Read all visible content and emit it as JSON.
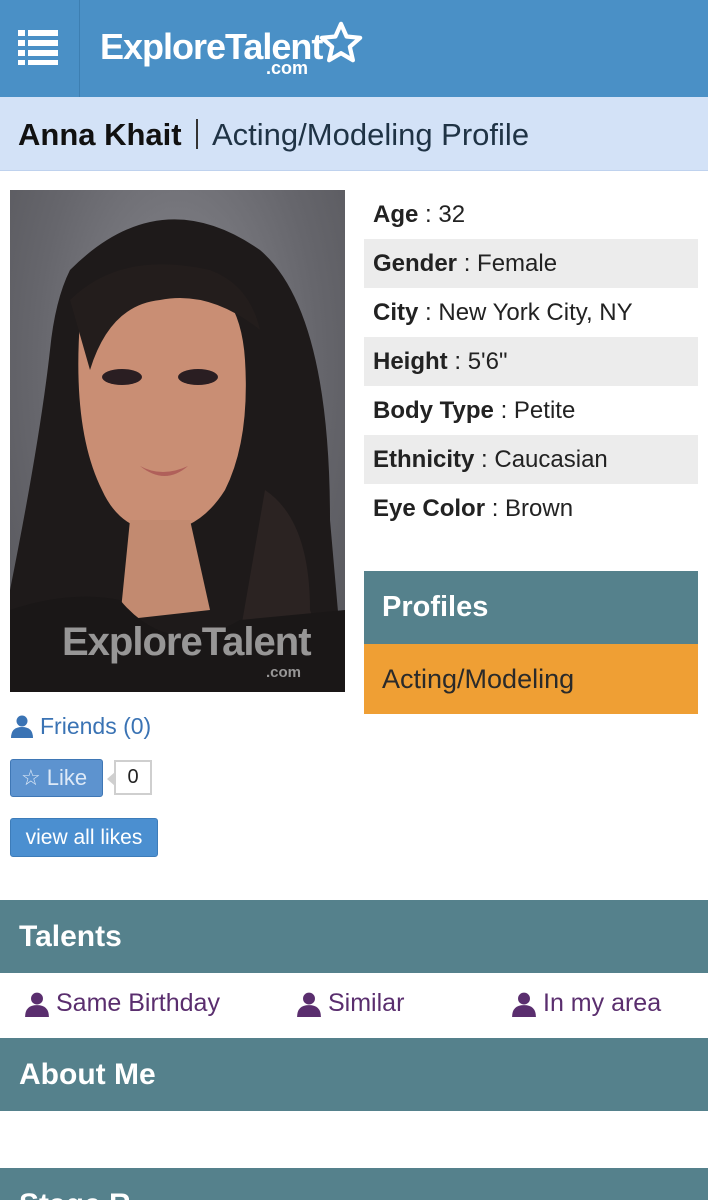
{
  "header": {
    "menu_icon": "list-menu-icon",
    "logo_text": "ExploreTalent",
    "logo_com": ".com",
    "logo_star_icon": "star-outline-icon",
    "brand_color": "#4a90c6"
  },
  "profile": {
    "name": "Anna Khait",
    "subtitle": "Acting/Modeling Profile"
  },
  "photo": {
    "watermark": "ExploreTalent",
    "watermark_com": ".com"
  },
  "details": [
    {
      "label": "Age",
      "value": "32"
    },
    {
      "label": "Gender",
      "value": "Female"
    },
    {
      "label": "City",
      "value": "New York City, NY"
    },
    {
      "label": "Height",
      "value": "5'6\""
    },
    {
      "label": "Body Type",
      "value": "Petite"
    },
    {
      "label": "Ethnicity",
      "value": "Caucasian"
    },
    {
      "label": "Eye Color",
      "value": "Brown"
    }
  ],
  "profiles": {
    "heading": "Profiles",
    "items": [
      "Acting/Modeling"
    ],
    "heading_color": "#55818c",
    "item_color": "#ef9f34"
  },
  "social": {
    "friends_label": "Friends (0)",
    "like_label": "Like",
    "like_count": "0",
    "view_all_likes": "view all likes"
  },
  "sections": {
    "talents": "Talents",
    "about": "About Me",
    "stage": "Stage R"
  },
  "talent_links": [
    "Same Birthday",
    "Similar",
    "In my area"
  ]
}
